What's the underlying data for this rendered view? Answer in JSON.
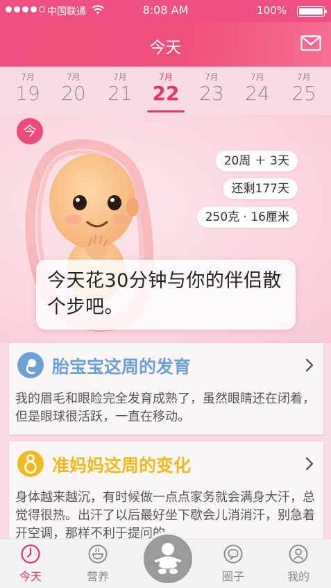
{
  "status": {
    "carrier": "中国联通",
    "time": "8:08 AM",
    "battery": "100%"
  },
  "nav": {
    "title": "今天"
  },
  "dates": [
    {
      "month": "7月",
      "day": "19"
    },
    {
      "month": "7月",
      "day": "20"
    },
    {
      "month": "7月",
      "day": "21"
    },
    {
      "month": "7月",
      "day": "22",
      "selected": true
    },
    {
      "month": "7月",
      "day": "23"
    },
    {
      "month": "7月",
      "day": "24"
    },
    {
      "month": "7月",
      "day": "25"
    }
  ],
  "hero": {
    "badge": "今",
    "weeks": "20周 ＋ 3天",
    "remaining": "还剩177天",
    "size": "250克 · 16厘米",
    "tip": "今天花30分钟与你的伴侣散个步吧。"
  },
  "cards": [
    {
      "title": "胎宝宝这周的发育",
      "title_color": "#6ea0d8",
      "body": "我的眉毛和眼睑完全发育成熟了，虽然眼睛还在闭着，但是眼球很活跃，一直在移动。"
    },
    {
      "title": "准妈妈这周的变化",
      "title_color": "#f0b91e",
      "body": "身体越来越沉，有时候做一点点家务就会满身大汗，总觉得很热。出汗了以后最好坐下歇会儿消消汗，别急着开空调，那样不利于提问的"
    }
  ],
  "tabs": [
    {
      "label": "今天",
      "icon": "clock-icon",
      "active": true
    },
    {
      "label": "营养",
      "icon": "bowl-icon"
    },
    {
      "label": "圈子",
      "icon": "chat-bubble-icon"
    },
    {
      "label": "我的",
      "icon": "user-icon"
    }
  ],
  "colors": {
    "brand": "#ef4f7d",
    "accent": "#e8336a",
    "card_blue": "#6ea0d8",
    "card_yellow": "#f0b91e"
  }
}
